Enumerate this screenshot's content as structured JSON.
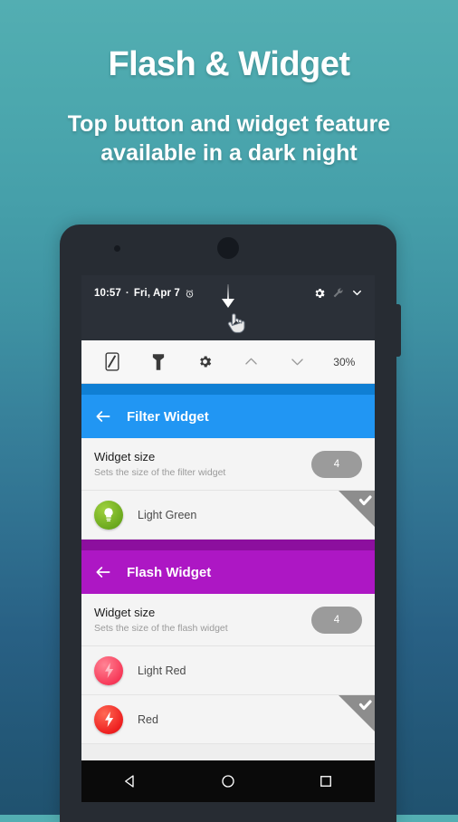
{
  "promo": {
    "title": "Flash & Widget",
    "subtitle_line1": "Top button and widget feature",
    "subtitle_line2": "available in a dark night"
  },
  "colors": {
    "bg_top": "#53AEB2",
    "bg_bottom": "#20526F",
    "filter_accent": "#2196f3",
    "flash_accent": "#ad17c4",
    "pill_bg": "#9b9b9b",
    "green_swatch": "#6aa81c",
    "light_red_swatch": "#f73a59",
    "red_swatch": "#ee2020"
  },
  "phone": {
    "statusbar": {
      "time": "10:57",
      "separator": "·",
      "date": "Fri, Apr 7",
      "alarm_icon": "alarm-clock-icon",
      "gear_icon": "gear-icon",
      "wrench_icon": "wrench-icon",
      "chevron_icon": "chevron-down-icon",
      "gesture_icon": "pull-down-arrow-hand-icon"
    },
    "quick_settings": {
      "items": [
        {
          "icon": "screen-filter-icon",
          "label": ""
        },
        {
          "icon": "flashlight-icon",
          "label": ""
        },
        {
          "icon": "gear-icon",
          "label": ""
        },
        {
          "icon": "chevron-up-icon",
          "label": ""
        },
        {
          "icon": "chevron-down-icon",
          "label": ""
        }
      ],
      "brightness": "30%"
    },
    "sections": [
      {
        "id": "filter-widget",
        "title": "Filter Widget",
        "back_icon": "back-arrow-icon",
        "preference": {
          "title": "Widget size",
          "summary": "Sets the size of the filter widget",
          "value": "4"
        },
        "options": [
          {
            "label": "Light Green",
            "icon": "bulb-icon",
            "selected": true
          }
        ]
      },
      {
        "id": "flash-widget",
        "title": "Flash Widget",
        "back_icon": "back-arrow-icon",
        "preference": {
          "title": "Widget size",
          "summary": "Sets the size of the flash widget",
          "value": "4"
        },
        "options": [
          {
            "label": "Light Red",
            "icon": "bolt-icon",
            "selected": false
          },
          {
            "label": "Red",
            "icon": "bolt-icon",
            "selected": true
          }
        ]
      }
    ],
    "navbar": {
      "back": "back-triangle-icon",
      "home": "home-circle-icon",
      "recents": "recents-square-icon"
    }
  }
}
